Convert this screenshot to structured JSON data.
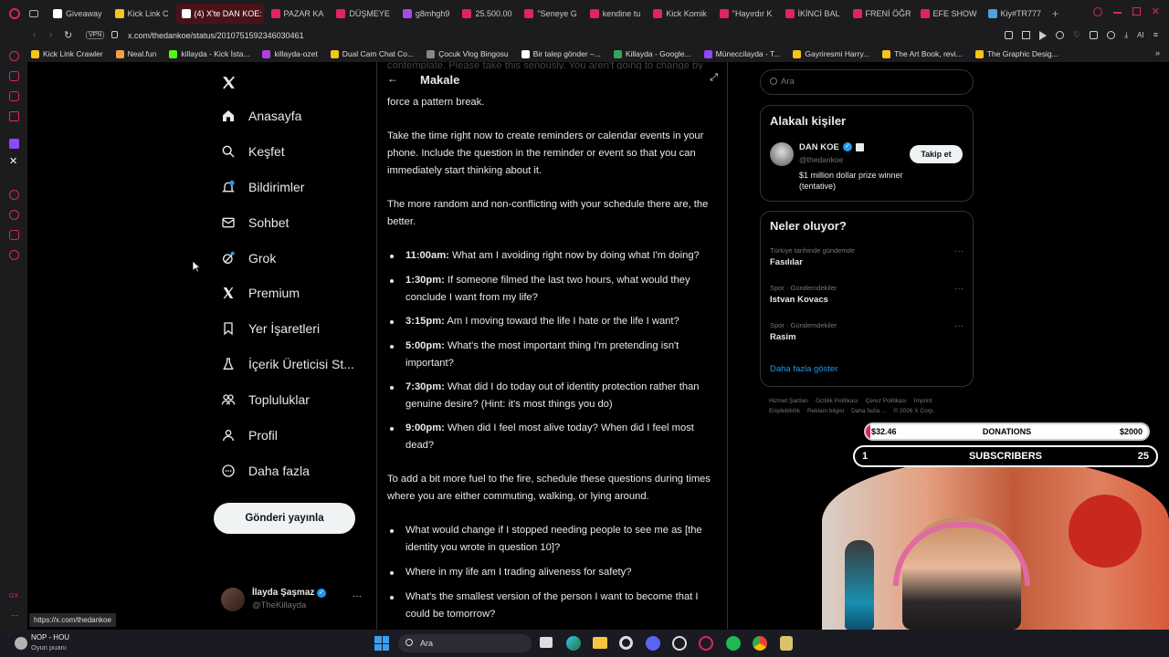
{
  "tabs": [
    {
      "label": "Giveaway",
      "color": "#ffffff"
    },
    {
      "label": "Kick Link C",
      "color": "#f5c518"
    },
    {
      "label": "(4) X'te DAN KOE: \"",
      "color": "#ffffff",
      "active": true
    },
    {
      "label": "PAZAR KA",
      "color": "#e0245e"
    },
    {
      "label": "DÜŞMEYE",
      "color": "#e0245e"
    },
    {
      "label": "g8mhgh9",
      "color": "#a64ce0"
    },
    {
      "label": "25.500.00",
      "color": "#e0245e"
    },
    {
      "label": "\"Seneye G",
      "color": "#e0245e"
    },
    {
      "label": "kendine tu",
      "color": "#e0245e"
    },
    {
      "label": "Kick Komik",
      "color": "#e0245e"
    },
    {
      "label": "\"Hayırdır K",
      "color": "#e0245e"
    },
    {
      "label": "İKİNCİ BAL",
      "color": "#e0245e"
    },
    {
      "label": "FRENİ ÖĞR",
      "color": "#e0245e"
    },
    {
      "label": "EFE SHOW",
      "color": "#e0245e"
    },
    {
      "label": "Kiy#TR777",
      "color": "#4aa3df"
    }
  ],
  "address": {
    "url": "x.com/thedankoe/status/2010751592346030461",
    "vpn": "VPN"
  },
  "bookmarks": [
    {
      "label": "Kick Link Crawler",
      "color": "#f5c518"
    },
    {
      "label": "Neal.fun",
      "color": "#f0a040"
    },
    {
      "label": "killayda - Kick İsta...",
      "color": "#53fc18"
    },
    {
      "label": "killayda-ozet",
      "color": "#b040e0"
    },
    {
      "label": "Dual Cam Chat Co...",
      "color": "#f5c518"
    },
    {
      "label": "Çocuk Vlog Bingosu",
      "color": "#888888"
    },
    {
      "label": "Bir talep gönder –...",
      "color": "#ffffff"
    },
    {
      "label": "Killayda - Google...",
      "color": "#34a853"
    },
    {
      "label": "Müneccilayda - T...",
      "color": "#9146ff"
    },
    {
      "label": "Gayriresmi Harry...",
      "color": "#f5c518"
    },
    {
      "label": "The Art Book, revi...",
      "color": "#f5c518"
    },
    {
      "label": "The Graphic Desig...",
      "color": "#f5c518"
    }
  ],
  "nav": [
    {
      "label": "Anasayfa",
      "icon": "home-icon"
    },
    {
      "label": "Keşfet",
      "icon": "search-icon"
    },
    {
      "label": "Bildirimler",
      "icon": "bell-icon"
    },
    {
      "label": "Sohbet",
      "icon": "mail-icon"
    },
    {
      "label": "Grok",
      "icon": "grok-icon"
    },
    {
      "label": "Premium",
      "icon": "x-icon"
    },
    {
      "label": "Yer İşaretleri",
      "icon": "bookmark-icon"
    },
    {
      "label": "İçerik Üreticisi St...",
      "icon": "flask-icon"
    },
    {
      "label": "Topluluklar",
      "icon": "people-icon"
    },
    {
      "label": "Profil",
      "icon": "person-icon"
    },
    {
      "label": "Daha fazla",
      "icon": "more-icon"
    }
  ],
  "post_button": "Gönderi yayınla",
  "account": {
    "name": "İlayda Şaşmaz",
    "handle": "@TheKillayda"
  },
  "article": {
    "header_title": "Makale",
    "faded_top": "contemplate. Please take this seriously. You aren't going to change by",
    "p0": "force a pattern break.",
    "p1": "Take the time right now to create reminders or calendar events in your phone. Include the question in the reminder or event so that you can immediately start thinking about it.",
    "p2": "The more random and non-conflicting with your schedule there are, the better.",
    "schedule": [
      {
        "time": "11:00am:",
        "text": " What am I avoiding right now by doing what I'm doing?"
      },
      {
        "time": "1:30pm:",
        "text": " If someone filmed the last two hours, what would they conclude I want from my life?"
      },
      {
        "time": "3:15pm:",
        "text": " Am I moving toward the life I hate or the life I want?"
      },
      {
        "time": "5:00pm:",
        "text": " What's the most important thing I'm pretending isn't important?"
      },
      {
        "time": "7:30pm:",
        "text": " What did I do today out of identity protection rather than genuine desire? (Hint: it's most things you do)"
      },
      {
        "time": "9:00pm:",
        "text": " When did I feel most alive today? When did I feel most dead?"
      }
    ],
    "p3": "To add a bit more fuel to the fire, schedule these questions during times where you are either commuting, walking, or lying around.",
    "questions": [
      "What would change if I stopped needing people to see me as [the identity you wrote in question 10]?",
      "Where in my life am I trading aliveness for safety?",
      "What's the smallest version of the person I want to become that I could be tomorrow?"
    ]
  },
  "sidebar": {
    "search_placeholder": "Ara",
    "related_title": "Alakalı kişiler",
    "person": {
      "name": "DAN KOE",
      "handle": "@thedankoe",
      "bio": "$1 million dollar prize winner (tentative)",
      "follow": "Takip et"
    },
    "trends_title": "Neler oluyor?",
    "trends": [
      {
        "meta": "Türkiye tarihinde gündemde",
        "name": "Fasılılar"
      },
      {
        "meta": "Spor · Gündemdekiler",
        "name": "Istvan Kovacs"
      },
      {
        "meta": "Spor · Gündemdekiler",
        "name": "Rasim"
      }
    ],
    "show_more": "Daha fazla göster",
    "footer": [
      "Hizmet Şartları",
      "Gizlilik Politikası",
      "Çerez Politikası",
      "Imprint",
      "Erişilebilirlik",
      "Reklam bilgisi",
      "Daha fazla ...",
      "© 2026 X Corp."
    ]
  },
  "overlay": {
    "donation_amount": "$32.46",
    "donation_label": "DONATIONS",
    "donation_goal": "$2000",
    "donation_progress": 0.016,
    "subs_count": "1",
    "subs_label": "SUBSCRIBERS",
    "subs_goal": "25"
  },
  "status_url": "https://x.com/thedankoe",
  "now_playing": {
    "title": "NOP - HOU",
    "subtitle": "Oyun puanı"
  },
  "taskbar": {
    "search": "Ara"
  },
  "colors": {
    "accent_x": "#1d9bf0",
    "tab_active": "#4a1218",
    "browser_red": "#e0245e"
  }
}
